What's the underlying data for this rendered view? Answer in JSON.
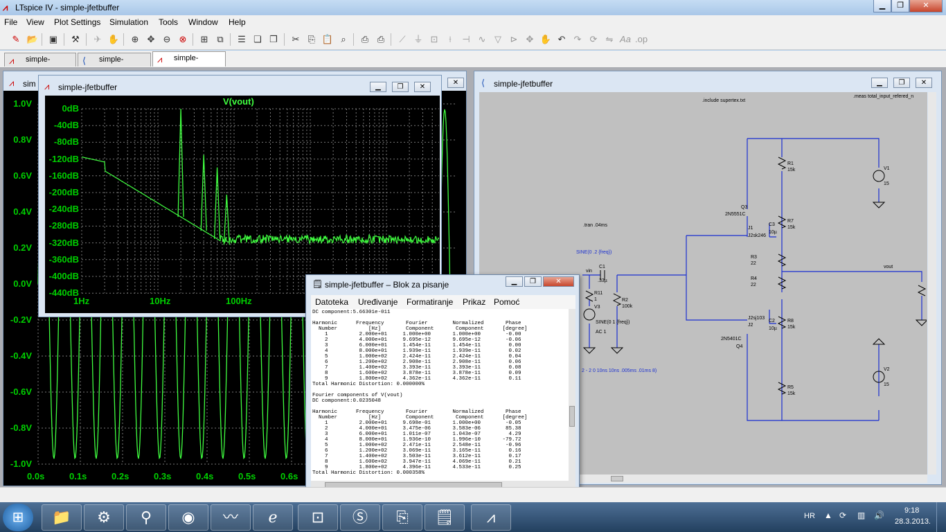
{
  "app": {
    "title": "LTspice IV - simple-jfetbuffer"
  },
  "menu": [
    "File",
    "View",
    "Plot Settings",
    "Simulation",
    "Tools",
    "Window",
    "Help"
  ],
  "tabs": [
    "simple-jfetbuffer",
    "simple-jfetbuffer",
    "simple-jfetbuffer"
  ],
  "wave_window": {
    "title_partial": "sim",
    "y_ticks": [
      "1.0V",
      "0.8V",
      "0.6V",
      "0.4V",
      "0.2V",
      "0.0V",
      "-0.2V",
      "-0.4V",
      "-0.6V",
      "-0.8V",
      "-1.0V"
    ],
    "x_ticks": [
      "0.0s",
      "0.1s",
      "0.2s",
      "0.3s",
      "0.4s",
      "0.5s",
      "0.6s"
    ]
  },
  "fft_window": {
    "title": "simple-jfetbuffer",
    "trace": "V(vout)",
    "y_ticks": [
      "0dB",
      "-40dB",
      "-80dB",
      "-120dB",
      "-160dB",
      "-200dB",
      "-240dB",
      "-280dB",
      "-320dB",
      "-360dB",
      "-400dB",
      "-440dB"
    ],
    "x_ticks": [
      "1Hz",
      "10Hz",
      "100Hz"
    ]
  },
  "schematic_window": {
    "title": "simple-jfetbuffer",
    "directives": {
      "include": ".include supertex.txt",
      "meas": ".meas total_input_refered_n",
      "tran": ".tran .04ms",
      "sine": "SINE(0 .2 {freq})",
      "pulse": "2 - 2 0 10ns 10ns .005ms .01ms 8)"
    },
    "labels": {
      "vin": "vin",
      "vout": "vout",
      "c1": "C1",
      "c1v": ".33µ",
      "r11": "R11",
      "r11v": "1",
      "v3": "V3",
      "v3s": "SINE(0 1 {freq})",
      "v3ac": "AC 1",
      "r2": "R2",
      "r2v": "100k",
      "r1": "R1",
      "r1v": "15k",
      "v1": "V1",
      "v1v": "15",
      "q3": "Q3",
      "q3v": "2N5551C",
      "j1": "J1",
      "j1v": "J2sk246",
      "c3": "C3",
      "c3v": "10µ",
      "r7": "R7",
      "r7v": "15k",
      "r3": "R3",
      "r3v": "22",
      "r4": "R4",
      "r4v": "22",
      "j2": "J2sj103",
      "j2n": "J2",
      "c2": "C2",
      "c2v": "10µ",
      "r8": "R8",
      "r8v": "15k",
      "q4": "Q4",
      "q4v": "2N5401C",
      "r5": "R5",
      "r5v": "15k",
      "v2": "V2",
      "v2v": "15"
    }
  },
  "notepad": {
    "title": "simple-jfetbuffer – Blok za pisanje",
    "menu": [
      "Datoteka",
      "Uređivanje",
      "Formatiranje",
      "Prikaz",
      "Pomoć"
    ],
    "lines": [
      "DC component:5.66301e-011",
      "",
      "Harmonic      Frequency       Fourier        Normalized       Phase",
      "  Number          [Hz]        Component       Component      [degree]",
      "    1          2.000e+01     1.000e+00       1.000e+00        -0.00",
      "    2          4.000e+01     9.695e-12       9.695e-12        -0.06",
      "    3          6.000e+01     1.454e-11       1.454e-11         0.00",
      "    4          8.000e+01     1.939e-11       1.939e-11         0.02",
      "    5          1.000e+02     2.424e-11       2.424e-11         0.04",
      "    6          1.200e+02     2.908e-11       2.908e-11         0.06",
      "    7          1.400e+02     3.393e-11       3.393e-11         0.08",
      "    8          1.600e+02     3.878e-11       3.878e-11         0.09",
      "    9          1.800e+02     4.362e-11       4.362e-11         0.11",
      "Total Harmonic Distortion: 0.000000%",
      "",
      "Fourier components of V(vout)",
      "DC component:0.0235048",
      "",
      "Harmonic      Frequency       Fourier        Normalized       Phase",
      "  Number          [Hz]        Component       Component      [degree]",
      "    1          2.000e+01     9.698e-01       1.000e+00        -0.05",
      "    2          4.000e+01     3.475e-06       3.583e-06        85.38",
      "    3          6.000e+01     1.011e-07       1.043e-07         4.29",
      "    4          8.000e+01     1.936e-10       1.996e-10       -79.72",
      "    5          1.000e+02     2.471e-11       2.548e-11        -0.96",
      "    6          1.200e+02     3.069e-11       3.165e-11         0.16",
      "    7          1.400e+02     3.503e-11       3.612e-11         0.17",
      "    8          1.600e+02     3.947e-11       4.069e-11         0.21",
      "    9          1.800e+02     4.396e-11       4.533e-11         0.25",
      "Total Harmonic Distortion: 0.000358%"
    ]
  },
  "tray": {
    "lang": "HR",
    "time": "9:18",
    "date": "28.3.2013."
  }
}
